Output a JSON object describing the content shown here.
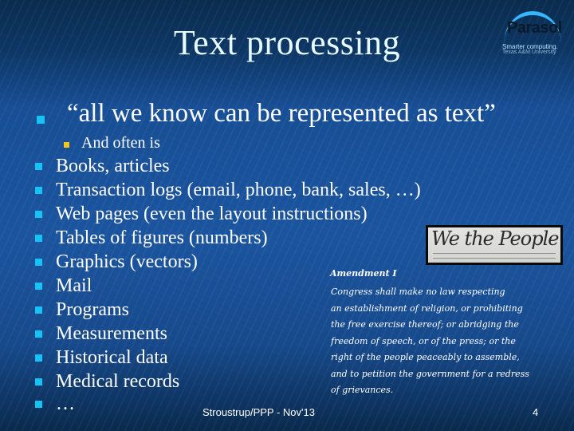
{
  "slide": {
    "title": "Text processing",
    "logo": {
      "name": "Parasol",
      "tagline": "Smarter computing.",
      "institution": "Texas A&M University"
    },
    "main_bullet": "“all we know can be represented as text”",
    "sub_bullet": "And often is",
    "items": [
      "Books, articles",
      "Transaction logs (email, phone, bank, sales, …)",
      "Web pages (even the layout instructions)",
      "Tables of figures (numbers)",
      "Graphics (vectors)",
      "Mail",
      "Programs",
      "Measurements",
      "Historical data",
      "Medical records",
      "…"
    ],
    "image_caption": "We the People",
    "amendment": {
      "title": "Amendment I",
      "lines": [
        "Congress shall make no law respecting",
        "an establishment of religion, or prohibiting",
        "the free exercise thereof; or abridging the",
        "freedom of speech, or of the press; or the",
        "right of the people peaceably to assemble,",
        "and to petition the government for a redress",
        "of grievances."
      ]
    },
    "footer": "Stroustrup/PPP - Nov'13",
    "page_number": "4"
  },
  "colors": {
    "bullet_primary": "#17c3f5",
    "bullet_secondary": "#f5c518",
    "title_text": "#e6faff",
    "logo_arc": "#35b6ff"
  }
}
